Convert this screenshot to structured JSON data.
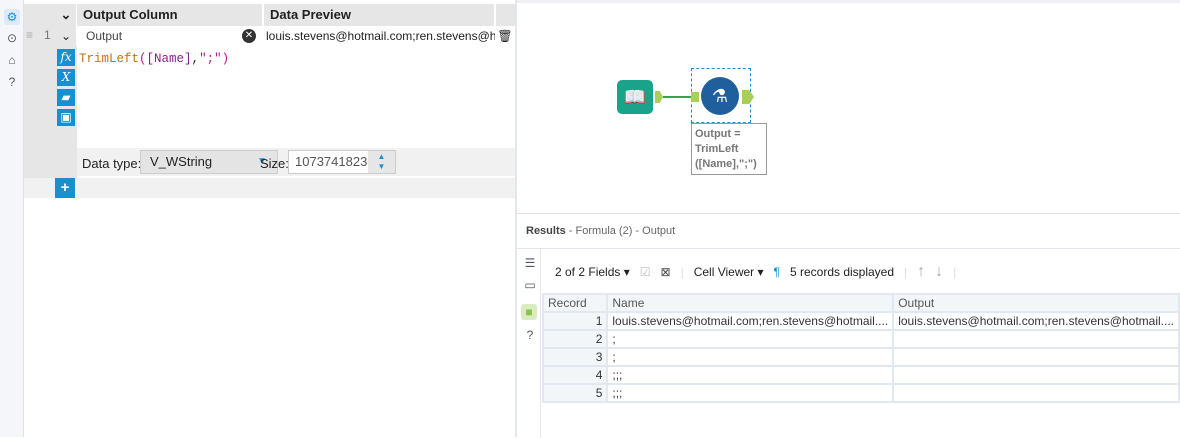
{
  "config": {
    "headers": {
      "output_column": "Output Column",
      "data_preview": "Data Preview"
    },
    "row": {
      "index": "1",
      "field": "Output",
      "preview": "louis.stevens@hotmail.com;ren.stevens@hc"
    },
    "expression": {
      "func": "TrimLeft",
      "open": "(",
      "field": "[Name]",
      "comma": ",",
      "str": "\";\"",
      "close": ")"
    },
    "data_type_label": "Data type:",
    "data_type": "V_WString",
    "size_label": "Size:",
    "size": "1073741823",
    "tool_buttons": {
      "fx": "fx",
      "var": "X",
      "add": "+"
    }
  },
  "canvas": {
    "annotation": "Output = TrimLeft ([Name],\";\")"
  },
  "results": {
    "title": "Results",
    "subtitle": "- Formula (2) - Output",
    "toolbar": {
      "fields": "2 of 2 Fields",
      "viewer": "Cell Viewer",
      "pilcrow": "¶",
      "records": "5 records displayed"
    },
    "columns": [
      "Record",
      "Name",
      "Output"
    ],
    "rows": [
      [
        "1",
        "louis.stevens@hotmail.com;ren.stevens@hotmail....",
        "louis.stevens@hotmail.com;ren.stevens@hotmail...."
      ],
      [
        "2",
        ";",
        ""
      ],
      [
        "3",
        ";",
        ""
      ],
      [
        "4",
        ";;;",
        ""
      ],
      [
        "5",
        ";;;",
        ""
      ]
    ]
  },
  "colors": {
    "accent": "#1a8fd0",
    "input_tool": "#1aa38a",
    "formula_tool": "#1f5f9c",
    "anchor": "#a7cf5a"
  }
}
